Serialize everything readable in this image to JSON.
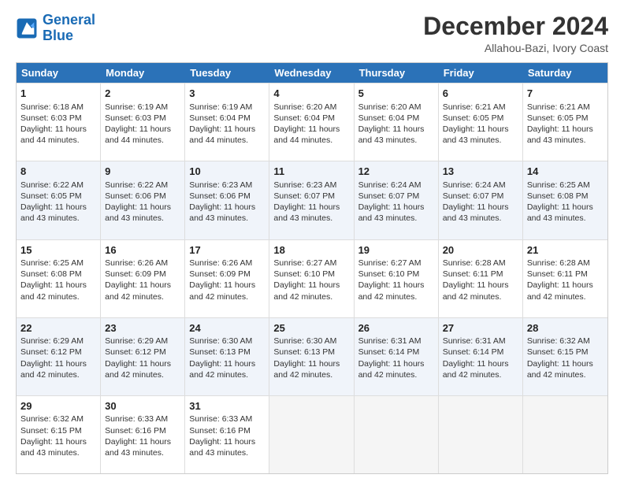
{
  "logo": {
    "line1": "General",
    "line2": "Blue"
  },
  "title": "December 2024",
  "subtitle": "Allahou-Bazi, Ivory Coast",
  "days": [
    "Sunday",
    "Monday",
    "Tuesday",
    "Wednesday",
    "Thursday",
    "Friday",
    "Saturday"
  ],
  "weeks": [
    [
      {
        "day": 1,
        "sunrise": "6:18 AM",
        "sunset": "6:03 PM",
        "daylight": "11 hours and 44 minutes."
      },
      {
        "day": 2,
        "sunrise": "6:19 AM",
        "sunset": "6:03 PM",
        "daylight": "11 hours and 44 minutes."
      },
      {
        "day": 3,
        "sunrise": "6:19 AM",
        "sunset": "6:04 PM",
        "daylight": "11 hours and 44 minutes."
      },
      {
        "day": 4,
        "sunrise": "6:20 AM",
        "sunset": "6:04 PM",
        "daylight": "11 hours and 44 minutes."
      },
      {
        "day": 5,
        "sunrise": "6:20 AM",
        "sunset": "6:04 PM",
        "daylight": "11 hours and 43 minutes."
      },
      {
        "day": 6,
        "sunrise": "6:21 AM",
        "sunset": "6:05 PM",
        "daylight": "11 hours and 43 minutes."
      },
      {
        "day": 7,
        "sunrise": "6:21 AM",
        "sunset": "6:05 PM",
        "daylight": "11 hours and 43 minutes."
      }
    ],
    [
      {
        "day": 8,
        "sunrise": "6:22 AM",
        "sunset": "6:05 PM",
        "daylight": "11 hours and 43 minutes."
      },
      {
        "day": 9,
        "sunrise": "6:22 AM",
        "sunset": "6:06 PM",
        "daylight": "11 hours and 43 minutes."
      },
      {
        "day": 10,
        "sunrise": "6:23 AM",
        "sunset": "6:06 PM",
        "daylight": "11 hours and 43 minutes."
      },
      {
        "day": 11,
        "sunrise": "6:23 AM",
        "sunset": "6:07 PM",
        "daylight": "11 hours and 43 minutes."
      },
      {
        "day": 12,
        "sunrise": "6:24 AM",
        "sunset": "6:07 PM",
        "daylight": "11 hours and 43 minutes."
      },
      {
        "day": 13,
        "sunrise": "6:24 AM",
        "sunset": "6:07 PM",
        "daylight": "11 hours and 43 minutes."
      },
      {
        "day": 14,
        "sunrise": "6:25 AM",
        "sunset": "6:08 PM",
        "daylight": "11 hours and 43 minutes."
      }
    ],
    [
      {
        "day": 15,
        "sunrise": "6:25 AM",
        "sunset": "6:08 PM",
        "daylight": "11 hours and 42 minutes."
      },
      {
        "day": 16,
        "sunrise": "6:26 AM",
        "sunset": "6:09 PM",
        "daylight": "11 hours and 42 minutes."
      },
      {
        "day": 17,
        "sunrise": "6:26 AM",
        "sunset": "6:09 PM",
        "daylight": "11 hours and 42 minutes."
      },
      {
        "day": 18,
        "sunrise": "6:27 AM",
        "sunset": "6:10 PM",
        "daylight": "11 hours and 42 minutes."
      },
      {
        "day": 19,
        "sunrise": "6:27 AM",
        "sunset": "6:10 PM",
        "daylight": "11 hours and 42 minutes."
      },
      {
        "day": 20,
        "sunrise": "6:28 AM",
        "sunset": "6:11 PM",
        "daylight": "11 hours and 42 minutes."
      },
      {
        "day": 21,
        "sunrise": "6:28 AM",
        "sunset": "6:11 PM",
        "daylight": "11 hours and 42 minutes."
      }
    ],
    [
      {
        "day": 22,
        "sunrise": "6:29 AM",
        "sunset": "6:12 PM",
        "daylight": "11 hours and 42 minutes."
      },
      {
        "day": 23,
        "sunrise": "6:29 AM",
        "sunset": "6:12 PM",
        "daylight": "11 hours and 42 minutes."
      },
      {
        "day": 24,
        "sunrise": "6:30 AM",
        "sunset": "6:13 PM",
        "daylight": "11 hours and 42 minutes."
      },
      {
        "day": 25,
        "sunrise": "6:30 AM",
        "sunset": "6:13 PM",
        "daylight": "11 hours and 42 minutes."
      },
      {
        "day": 26,
        "sunrise": "6:31 AM",
        "sunset": "6:14 PM",
        "daylight": "11 hours and 42 minutes."
      },
      {
        "day": 27,
        "sunrise": "6:31 AM",
        "sunset": "6:14 PM",
        "daylight": "11 hours and 42 minutes."
      },
      {
        "day": 28,
        "sunrise": "6:32 AM",
        "sunset": "6:15 PM",
        "daylight": "11 hours and 42 minutes."
      }
    ],
    [
      {
        "day": 29,
        "sunrise": "6:32 AM",
        "sunset": "6:15 PM",
        "daylight": "11 hours and 43 minutes."
      },
      {
        "day": 30,
        "sunrise": "6:33 AM",
        "sunset": "6:16 PM",
        "daylight": "11 hours and 43 minutes."
      },
      {
        "day": 31,
        "sunrise": "6:33 AM",
        "sunset": "6:16 PM",
        "daylight": "11 hours and 43 minutes."
      },
      null,
      null,
      null,
      null
    ]
  ],
  "labels": {
    "sunrise": "Sunrise: ",
    "sunset": "Sunset: ",
    "daylight": "Daylight: "
  }
}
